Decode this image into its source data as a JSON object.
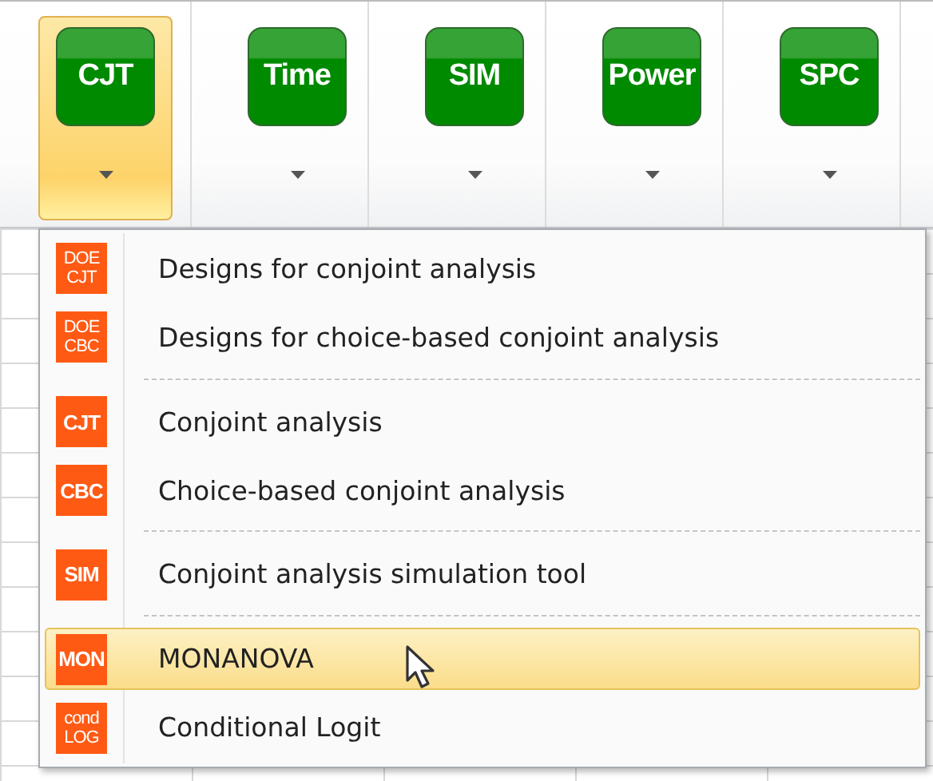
{
  "ribbon": {
    "buttons": [
      {
        "label": "CJT",
        "selected": true
      },
      {
        "label": "Time",
        "selected": false
      },
      {
        "label": "SIM",
        "selected": false
      },
      {
        "label": "Power",
        "selected": false
      },
      {
        "label": "SPC",
        "selected": false
      }
    ]
  },
  "menu": {
    "groups": [
      [
        {
          "icon_text": [
            "DOE",
            "CJT"
          ],
          "label": "Designs for conjoint analysis",
          "selected": false
        },
        {
          "icon_text": [
            "DOE",
            "CBC"
          ],
          "label": "Designs for choice-based conjoint analysis",
          "selected": false
        }
      ],
      [
        {
          "icon_text": [
            "CJT"
          ],
          "label": "Conjoint analysis",
          "selected": false
        },
        {
          "icon_text": [
            "CBC"
          ],
          "label": "Choice-based conjoint analysis",
          "selected": false
        }
      ],
      [
        {
          "icon_text": [
            "SIM"
          ],
          "label": "Conjoint analysis simulation tool",
          "selected": false
        }
      ],
      [
        {
          "icon_text": [
            "MON"
          ],
          "label": "MONANOVA",
          "selected": true
        },
        {
          "icon_text": [
            "cond",
            "LOG"
          ],
          "label": "Conditional Logit",
          "selected": false
        }
      ]
    ]
  }
}
